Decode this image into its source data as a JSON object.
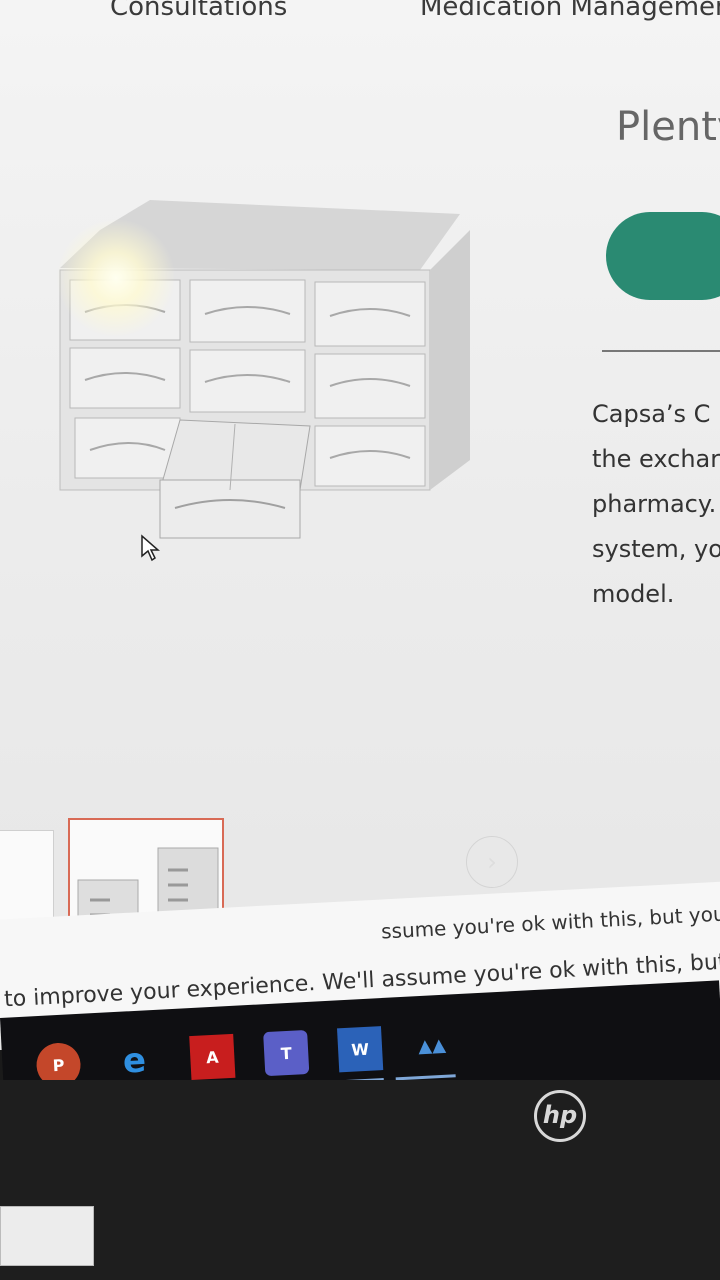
{
  "nav": {
    "left_label": "Consultations",
    "right_label": "Medication Managemen"
  },
  "section": {
    "heading": "Plenty",
    "paragraph_lines": [
      "Capsa’s C",
      "the exchar",
      "pharmacy.",
      "system, yo",
      "model."
    ]
  },
  "carousel": {
    "next_glyph": "›"
  },
  "cookie": {
    "text_right": "ssume you're ok with this, but you",
    "text_left": "to improve your experience. We'll assume you're ok with this, but you"
  },
  "taskbar": {
    "icons": [
      "powerpoint-icon",
      "edge-icon",
      "acrobat-icon",
      "teams-icon",
      "word-icon",
      "chart-app-icon"
    ],
    "labels": {
      "powerpoint": "P",
      "edge": "e",
      "acrobat": "A",
      "teams": "T",
      "word": "W",
      "chart": "▲▲"
    }
  },
  "hardware": {
    "brand": "hp"
  },
  "colors": {
    "accent_green": "#2a8a72",
    "thumb_border": "#d86a55",
    "taskbar": "#0f0f12"
  }
}
